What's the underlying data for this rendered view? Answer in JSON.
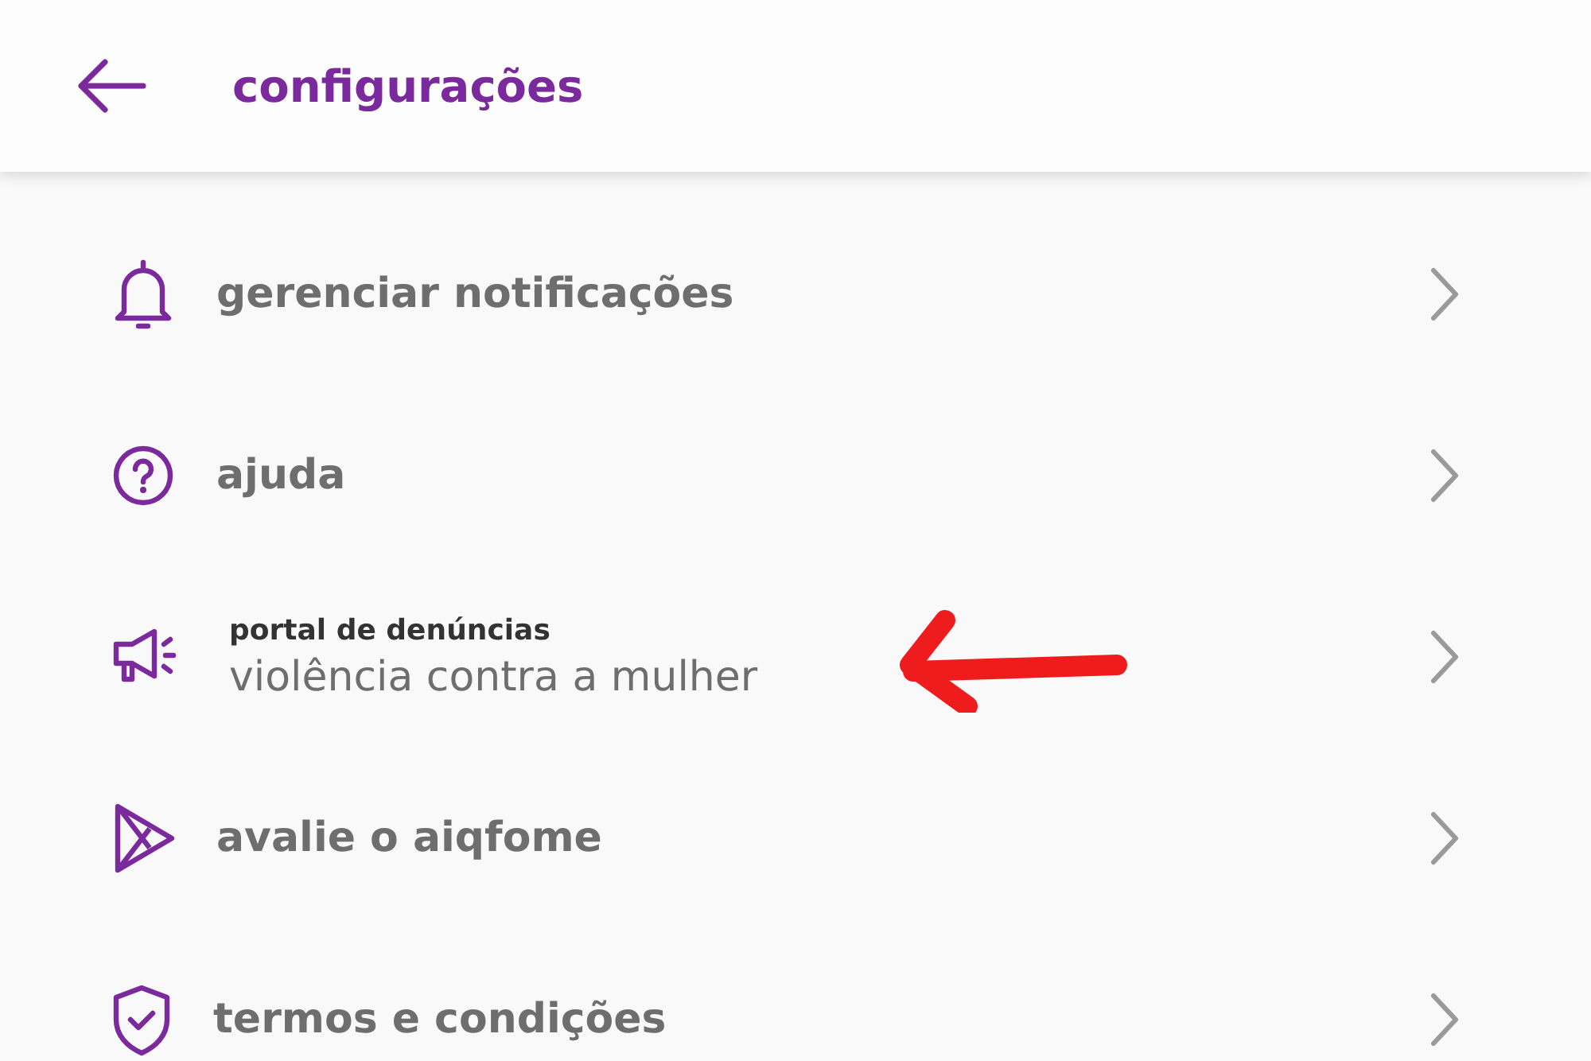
{
  "header": {
    "title": "configurações"
  },
  "items": [
    {
      "label": "gerenciar notificações"
    },
    {
      "label": "ajuda"
    },
    {
      "overline": "portal de denúncias",
      "label": "violência contra a mulher"
    },
    {
      "label": "avalie o aiqfome"
    },
    {
      "label": "termos e condições"
    }
  ]
}
